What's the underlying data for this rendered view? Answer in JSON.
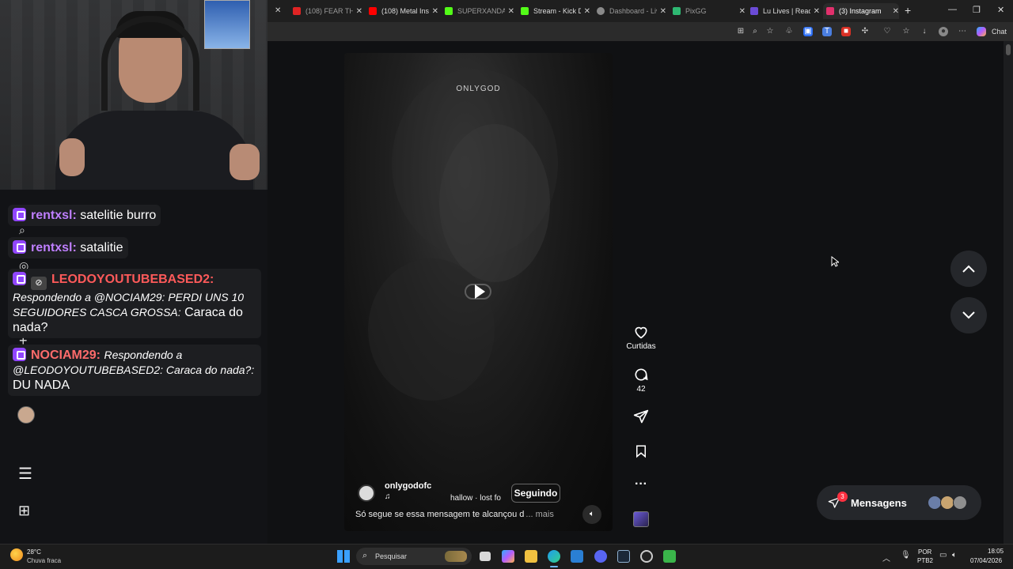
{
  "browser": {
    "tabs": [
      {
        "label": "(108) FEAR THE",
        "color": "#e02424"
      },
      {
        "label": "(108) Metal Insti",
        "color": "#ff0000"
      },
      {
        "label": "SUPERXANDAO",
        "color": "#53fc18"
      },
      {
        "label": "Stream - Kick Da",
        "color": "#53fc18"
      },
      {
        "label": "Dashboard - Liv",
        "color": "#8a8a8a"
      },
      {
        "label": "PixGG",
        "color": "#2eb872"
      },
      {
        "label": "Lu Lives | React",
        "color": "#6b4bd6"
      },
      {
        "label": "(3) Instagram",
        "color": "#e1306c"
      }
    ],
    "chat_button": "Chat"
  },
  "chat": {
    "messages": [
      {
        "user": "rentxsl:",
        "user_color": "#bf7fff",
        "text": "satelitie burro"
      },
      {
        "user": "rentxsl:",
        "user_color": "#bf7fff",
        "text": "satalitie"
      },
      {
        "user": "LEODOYOUTUBEBASED2:",
        "user_color": "#ff5a5a",
        "reply": "Respondendo a @NOCIAM29: PERDI UNS 10 SEGUIDORES CASCA GROSSA:",
        "text": "Caraca do nada?"
      },
      {
        "user": "NOCIAM29:",
        "user_color": "#ff6b6b",
        "reply": "Respondendo a @LEODOYOUTUBEBASED2: Caraca do nada?:",
        "text": "DU NADA"
      }
    ]
  },
  "reel": {
    "watermark": "ONLYGOD",
    "username": "onlygodofc",
    "audio": "hallow · lost fo",
    "follow_label": "Seguindo",
    "caption": "Só segue se essa mensagem te alcançou d",
    "more": "... mais"
  },
  "actions": {
    "likes_label": "Curtidas",
    "comments_count": "42"
  },
  "messages_pill": {
    "label": "Mensagens",
    "badge": "3"
  },
  "taskbar": {
    "weather_temp": "28°C",
    "weather_desc": "Chuva fraca",
    "search_placeholder": "Pesquisar",
    "lang_top": "POR",
    "lang_bottom": "PTB2",
    "time": "18:05",
    "date": "07/04/2026"
  }
}
